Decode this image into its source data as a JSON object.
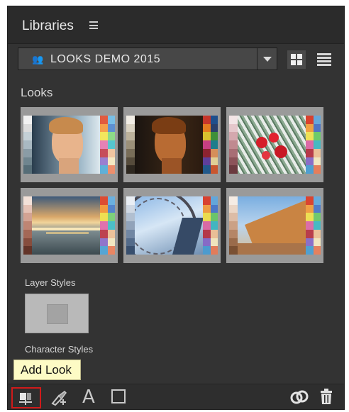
{
  "panel": {
    "title": "Libraries"
  },
  "library_selector": {
    "value": "LOOKS DEMO 2015"
  },
  "sections": {
    "looks": "Looks",
    "layer_styles": "Layer Styles",
    "character_styles": "Character Styles"
  },
  "looks": [
    {
      "name": "look-portrait-blue"
    },
    {
      "name": "look-portrait-warm"
    },
    {
      "name": "look-flowers"
    },
    {
      "name": "look-seaside-sunset"
    },
    {
      "name": "look-ferris-wheel"
    },
    {
      "name": "look-cliff"
    }
  ],
  "tooltip": {
    "text": "Add Look"
  },
  "footer_icons": [
    "add-look-icon",
    "paint-brush-icon",
    "text-style-icon",
    "shape-icon",
    "creative-cloud-icon",
    "trash-icon"
  ]
}
